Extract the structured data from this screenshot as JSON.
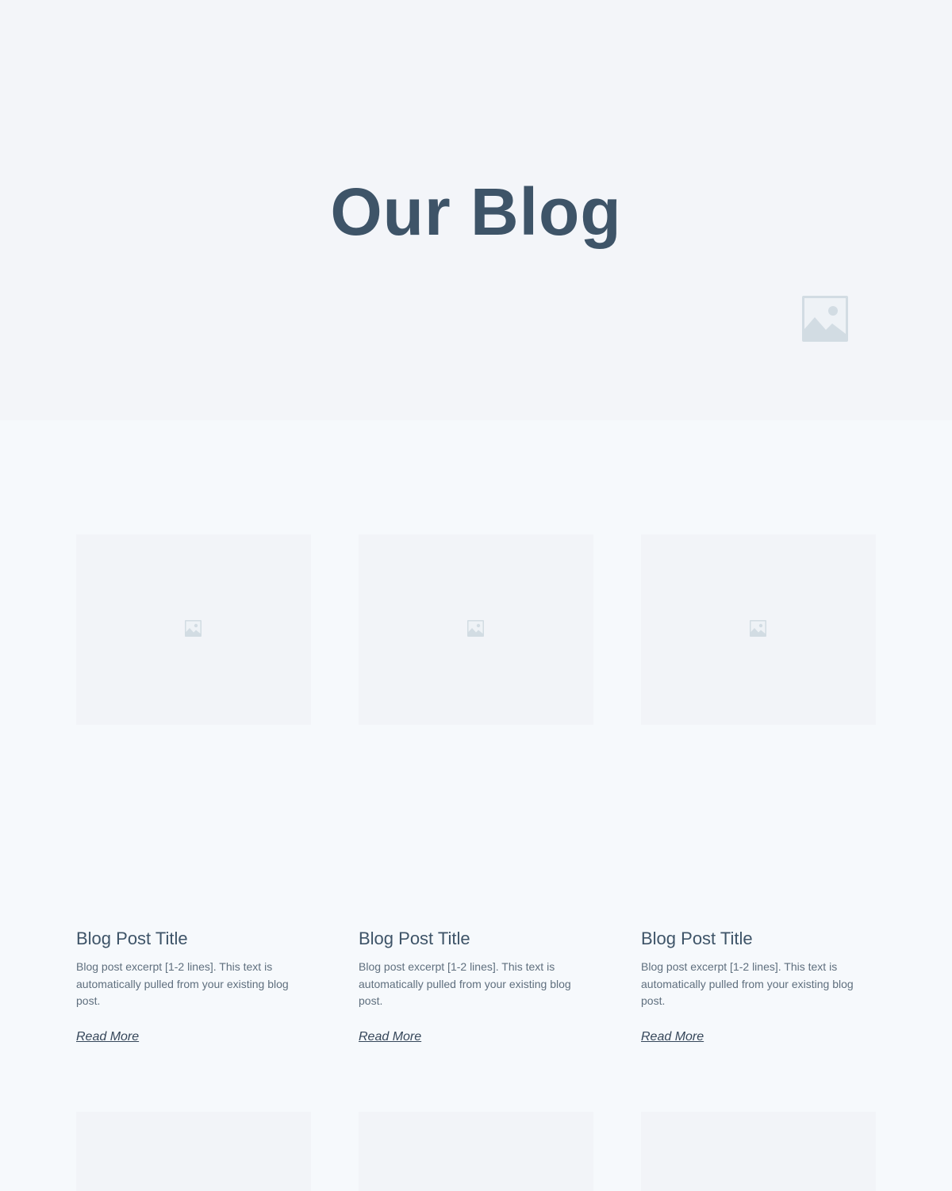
{
  "hero": {
    "title": "Our Blog",
    "image_icon": "image-placeholder-icon"
  },
  "posts": [
    {
      "title": "Blog Post Title",
      "excerpt": "Blog post excerpt [1-2 lines]. This text is automatically pulled from your existing blog post.",
      "link_label": "Read More",
      "image_icon": "image-placeholder-icon"
    },
    {
      "title": "Blog Post Title",
      "excerpt": "Blog post excerpt [1-2 lines]. This text is automatically pulled from your existing blog post.",
      "link_label": "Read More",
      "image_icon": "image-placeholder-icon"
    },
    {
      "title": "Blog Post Title",
      "excerpt": "Blog post excerpt [1-2 lines]. This text is automatically pulled from your existing blog post.",
      "link_label": "Read More",
      "image_icon": "image-placeholder-icon"
    }
  ],
  "colors": {
    "hero_bg": "#f3f5f9",
    "page_bg": "#f6f9fc",
    "title": "#3e5468",
    "text": "#5f6f7e",
    "placeholder": "#d2dce3"
  }
}
